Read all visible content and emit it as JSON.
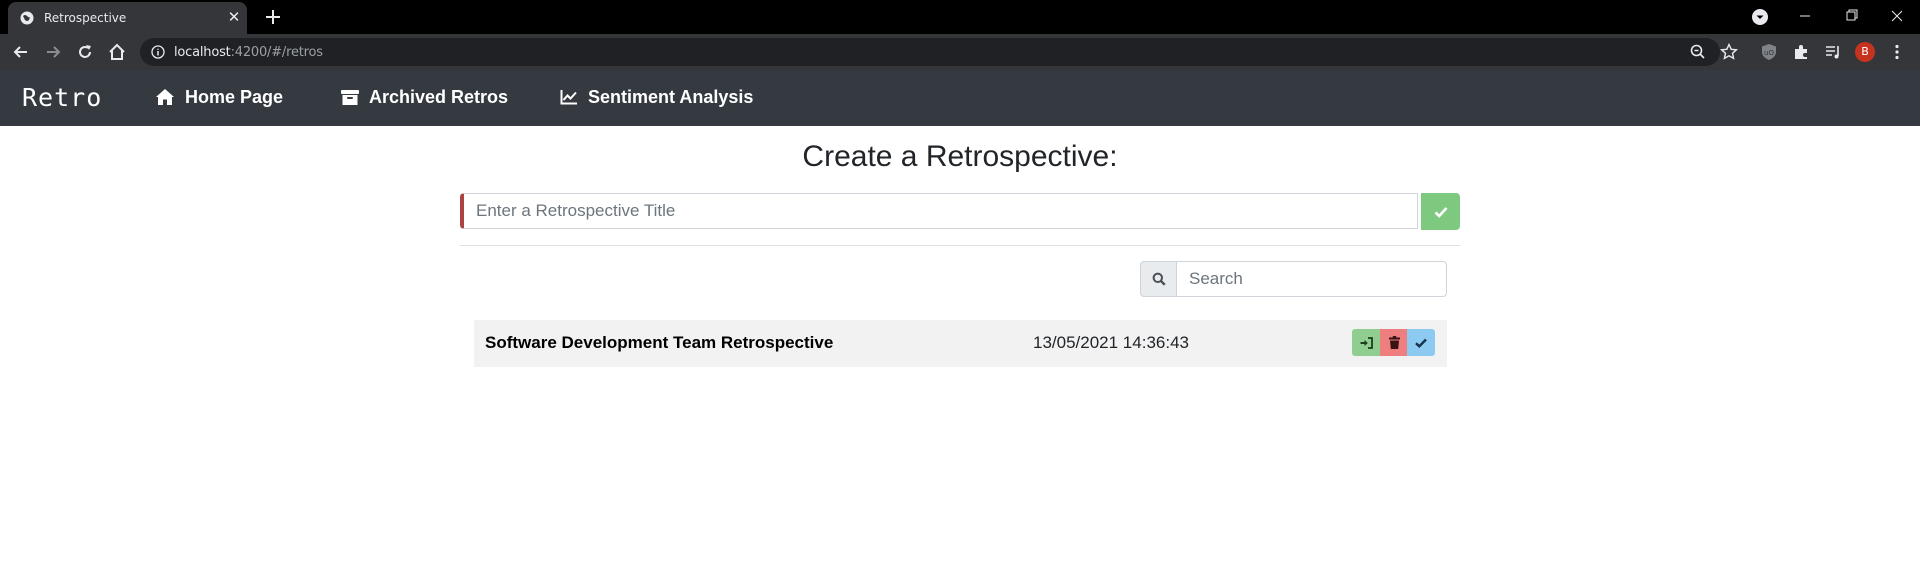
{
  "browser": {
    "tab_title": "Retrospective",
    "url_host": "localhost",
    "url_path": ":4200/#/retros",
    "profile_initial": "B"
  },
  "navbar": {
    "brand": "Retro",
    "items": [
      {
        "label": "Home Page",
        "icon": "home-icon"
      },
      {
        "label": "Archived Retros",
        "icon": "archive-icon"
      },
      {
        "label": "Sentiment Analysis",
        "icon": "line-chart-icon"
      }
    ]
  },
  "create": {
    "heading": "Create a Retrospective:",
    "input_placeholder": "Enter a Retrospective Title",
    "input_value": "",
    "submit_icon": "check-icon"
  },
  "search": {
    "placeholder": "Search",
    "value": "",
    "icon": "search-icon"
  },
  "retros": [
    {
      "title": "Software Development Team Retrospective",
      "date": "13/05/2021 14:36:43",
      "actions": [
        "join-icon",
        "trash-icon",
        "check-icon"
      ]
    }
  ],
  "colors": {
    "navbar": "#343a40",
    "submit": "#7dc97f",
    "join": "#8fce8f",
    "delete": "#ef7f7f",
    "archive": "#8ccaf2",
    "input_accent": "#a94442"
  }
}
